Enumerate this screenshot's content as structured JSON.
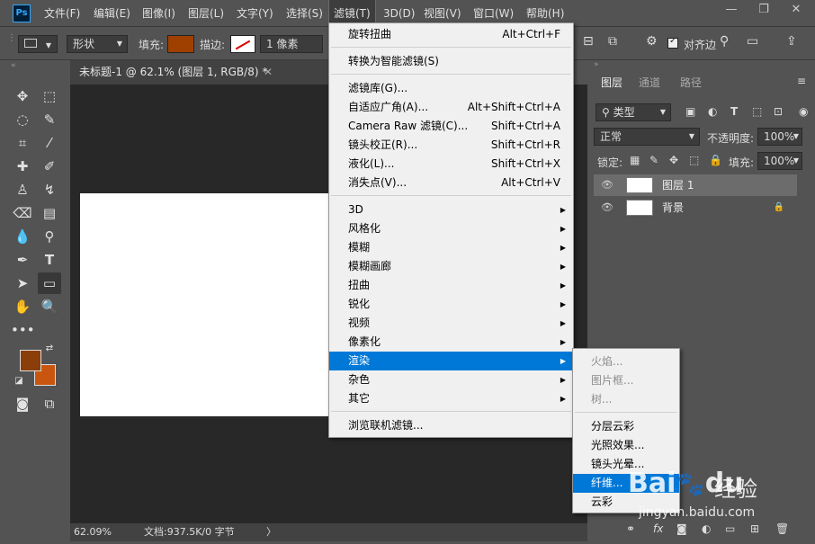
{
  "menubar": {
    "logo": "Ps",
    "items": [
      "文件(F)",
      "编辑(E)",
      "图像(I)",
      "图层(L)",
      "文字(Y)",
      "选择(S)",
      "滤镜(T)",
      "3D(D)",
      "视图(V)",
      "窗口(W)",
      "帮助(H)"
    ],
    "open_item": "滤镜(T)",
    "window_buttons": [
      "—",
      "❐",
      "✕"
    ]
  },
  "options": {
    "shape_mode": "形状",
    "fill_label": "填充:",
    "stroke_label": "描边:",
    "stroke_width": "1 像素",
    "align_edges": "对齐边",
    "fill_color": "#a04000"
  },
  "document_tab": {
    "title": "未标题-1 @ 62.1% (图层 1, RGB/8) *",
    "close": "✕"
  },
  "status": {
    "zoom": "62.09%",
    "doc_info": "文档:937.5K/0 字节",
    "arrow": "〉"
  },
  "colors": {
    "foreground": "#8b3d0a",
    "background": "#c8560e",
    "highlight": "#0078d7"
  },
  "filter_menu": {
    "items": [
      {
        "label": "旋转扭曲",
        "shortcut": "Alt+Ctrl+F"
      },
      {
        "sep": true
      },
      {
        "label": "转换为智能滤镜(S)",
        "shortcut": ""
      },
      {
        "sep": true
      },
      {
        "label": "滤镜库(G)...",
        "shortcut": ""
      },
      {
        "label": "自适应广角(A)...",
        "shortcut": "Alt+Shift+Ctrl+A"
      },
      {
        "label": "Camera Raw 滤镜(C)...",
        "shortcut": "Shift+Ctrl+A"
      },
      {
        "label": "镜头校正(R)...",
        "shortcut": "Shift+Ctrl+R"
      },
      {
        "label": "液化(L)...",
        "shortcut": "Shift+Ctrl+X"
      },
      {
        "label": "消失点(V)...",
        "shortcut": "Alt+Ctrl+V"
      },
      {
        "sep": true
      },
      {
        "label": "3D",
        "sub": true
      },
      {
        "label": "风格化",
        "sub": true
      },
      {
        "label": "模糊",
        "sub": true
      },
      {
        "label": "模糊画廊",
        "sub": true
      },
      {
        "label": "扭曲",
        "sub": true
      },
      {
        "label": "锐化",
        "sub": true
      },
      {
        "label": "视频",
        "sub": true
      },
      {
        "label": "像素化",
        "sub": true
      },
      {
        "label": "渲染",
        "sub": true,
        "highlighted": true
      },
      {
        "label": "杂色",
        "sub": true
      },
      {
        "label": "其它",
        "sub": true
      },
      {
        "sep": true
      },
      {
        "label": "浏览联机滤镜...",
        "shortcut": ""
      }
    ]
  },
  "render_submenu": {
    "items": [
      {
        "label": "火焰...",
        "disabled": true
      },
      {
        "label": "图片框...",
        "disabled": true
      },
      {
        "label": "树...",
        "disabled": true
      },
      {
        "sep": true
      },
      {
        "label": "分层云彩"
      },
      {
        "label": "光照效果..."
      },
      {
        "label": "镜头光晕..."
      },
      {
        "label": "纤维...",
        "highlighted": true
      },
      {
        "label": "云彩"
      }
    ]
  },
  "layers_panel": {
    "tabs": [
      "图层",
      "通道",
      "路径"
    ],
    "active_tab": "图层",
    "filter_kind": "类型",
    "blend_mode": "正常",
    "opacity_label": "不透明度:",
    "opacity_value": "100%",
    "lock_label": "锁定:",
    "fill_label": "填充:",
    "fill_value": "100%",
    "layers": [
      {
        "name": "图层 1",
        "selected": true
      },
      {
        "name": "背景",
        "locked": true
      }
    ]
  },
  "watermark": {
    "brand": "Bai",
    "brand2": "du",
    "cn": "经验",
    "url": "jingyan.baidu.com"
  }
}
